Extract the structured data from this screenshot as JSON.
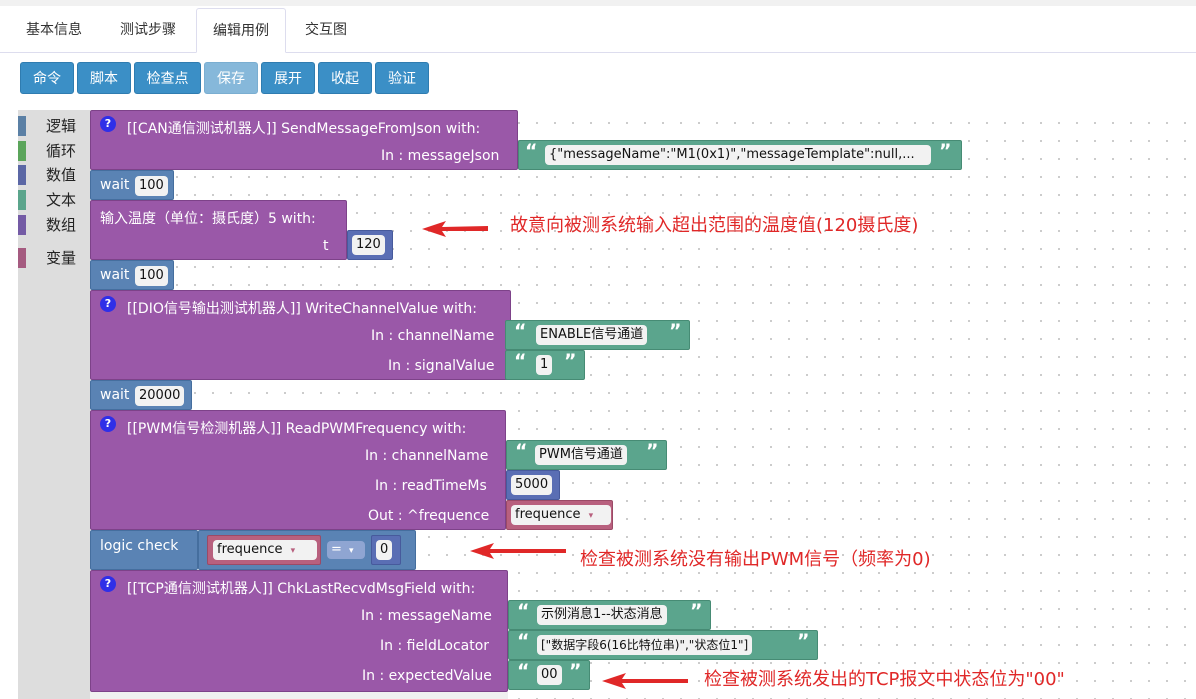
{
  "tabs": [
    "基本信息",
    "测试步骤",
    "编辑用例",
    "交互图"
  ],
  "toolbar": {
    "cmd": "命令",
    "script": "脚本",
    "checkpoint": "检查点",
    "save": "保存",
    "expand": "展开",
    "collapse": "收起",
    "verify": "验证"
  },
  "categories": [
    {
      "label": "逻辑",
      "color": "#5b80a5"
    },
    {
      "label": "循环",
      "color": "#5ba55b"
    },
    {
      "label": "数值",
      "color": "#5b67a5"
    },
    {
      "label": "文本",
      "color": "#5ba58c"
    },
    {
      "label": "数组",
      "color": "#745ba5"
    },
    {
      "label": "变量",
      "color": "#a55b80"
    }
  ],
  "blocks": {
    "b1": {
      "title": "[[CAN通信测试机器人]]  SendMessageFromJson  with:",
      "p1": "In : messageJson",
      "v1": "{\"messageName\":\"M1(0x1)\",\"messageTemplate\":null,..."
    },
    "w1": {
      "label": "wait",
      "value": "100"
    },
    "b2": {
      "title": "输入温度（单位：摄氏度）5  with:",
      "p1": "t",
      "v1": "120"
    },
    "w2": {
      "label": "wait",
      "value": "100"
    },
    "b3": {
      "title": "[[DIO信号输出测试机器人]]  WriteChannelValue  with:",
      "p1": "In : channelName",
      "v1": "ENABLE信号通道",
      "p2": "In : signalValue",
      "v2": "1"
    },
    "w3": {
      "label": "wait",
      "value": "20000"
    },
    "b4": {
      "title": "[[PWM信号检测机器人]]  ReadPWMFrequency  with:",
      "p1": "In : channelName",
      "v1": "PWM信号通道",
      "p2": "In : readTimeMs",
      "v2": "5000",
      "p3": "Out : ^frequence",
      "v3": "frequence"
    },
    "lc": {
      "label": "logic check",
      "var": "frequence",
      "op": "=",
      "value": "0"
    },
    "b5": {
      "title": "[[TCP通信测试机器人]]  ChkLastRecvdMsgField  with:",
      "p1": "In : messageName",
      "v1": "示例消息1--状态消息",
      "p2": "In : fieldLocator",
      "v2": "[\"数据字段6(16比特位串)\",\"状态位1\"]",
      "p3": "In : expectedValue",
      "v3": "00"
    }
  },
  "notes": {
    "n1": "故意向被测系统输入超出范围的温度值(120摄氏度)",
    "n2": "检查被测系统没有输出PWM信号（频率为0)",
    "n3": "检查被测系统发出的TCP报文中状态位为\"00\""
  },
  "glyphs": {
    "open": "“",
    "close": "”",
    "help": "?",
    "dropdown": "▾"
  }
}
